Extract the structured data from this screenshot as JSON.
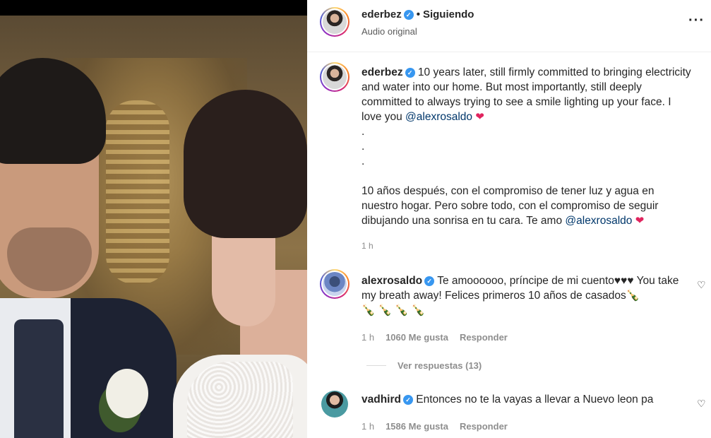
{
  "post": {
    "username": "ederbez",
    "follow_status": "Siguiendo",
    "audio": "Audio original",
    "more_icon": "more-horizontal-icon"
  },
  "caption": {
    "username": "ederbez",
    "text_en": "10 years later, still firmly committed to bringing electricity and water into our home. But most importantly, still deeply committed to always trying to see a smile lighting up your face. I love you",
    "mention_en": "@alexrosaldo",
    "dots": [
      ".",
      ".",
      "."
    ],
    "text_es": "10 años después, con el compromiso de tener luz y agua en nuestro hogar. Pero sobre todo, con el compromiso de seguir dibujando una sonrisa en tu cara. Te amo",
    "mention_es": "@alexrosaldo",
    "heart": "❤",
    "time": "1 h"
  },
  "comments": [
    {
      "username": "alexrosaldo",
      "text": "Te amoooooo, príncipe de mi cuento♥♥♥ You take my breath away! Felices primeros 10 años de casados",
      "emoji_inline": "🍾",
      "emoji_row": "🍾 🍾 🍾 🍾",
      "time": "1 h",
      "likes": "1060 Me gusta",
      "reply": "Responder",
      "view_replies": "Ver respuestas (13)"
    },
    {
      "username": "vadhird",
      "text": "Entonces no te la vayas a llevar a Nuevo leon pa",
      "time": "1 h",
      "likes": "1586 Me gusta",
      "reply": "Responder"
    }
  ],
  "colors": {
    "verified": "#3897f0",
    "mention": "#00376b",
    "heart": "#e0245e",
    "meta": "#8e8e8e"
  }
}
